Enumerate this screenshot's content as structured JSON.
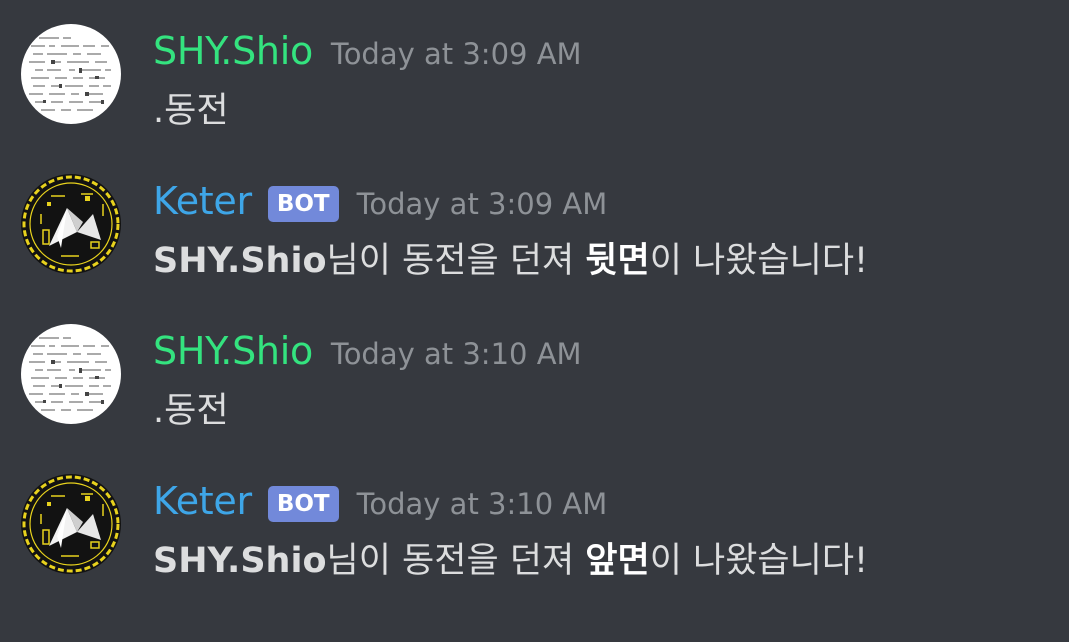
{
  "colors": {
    "background": "#36393f",
    "user_color": "#2ecc71",
    "bot_color": "#3498db",
    "bot_tag_bg": "#7289da",
    "timestamp": "#8e9297",
    "text": "#dcddde"
  },
  "messages": [
    {
      "author": "SHY.Shio",
      "author_color": "#34e37f",
      "is_bot": false,
      "timestamp": "Today at 3:09 AM",
      "content": ".동전",
      "avatar_icon": "document-avatar-icon"
    },
    {
      "author": "Keter",
      "author_color": "#3ea6e8",
      "is_bot": true,
      "bot_label": "BOT",
      "timestamp": "Today at 3:09 AM",
      "content_parts": {
        "mention": "SHY.Shio",
        "middle": "님이 동전을 던져 ",
        "result": "뒷면",
        "end": "이 나왔습니다!"
      },
      "avatar_icon": "keter-logo-avatar-icon"
    },
    {
      "author": "SHY.Shio",
      "author_color": "#34e37f",
      "is_bot": false,
      "timestamp": "Today at 3:10 AM",
      "content": ".동전",
      "avatar_icon": "document-avatar-icon"
    },
    {
      "author": "Keter",
      "author_color": "#3ea6e8",
      "is_bot": true,
      "bot_label": "BOT",
      "timestamp": "Today at 3:10 AM",
      "content_parts": {
        "mention": "SHY.Shio",
        "middle": "님이 동전을 던져 ",
        "result": "앞면",
        "end": "이 나왔습니다!"
      },
      "avatar_icon": "keter-logo-avatar-icon"
    }
  ]
}
